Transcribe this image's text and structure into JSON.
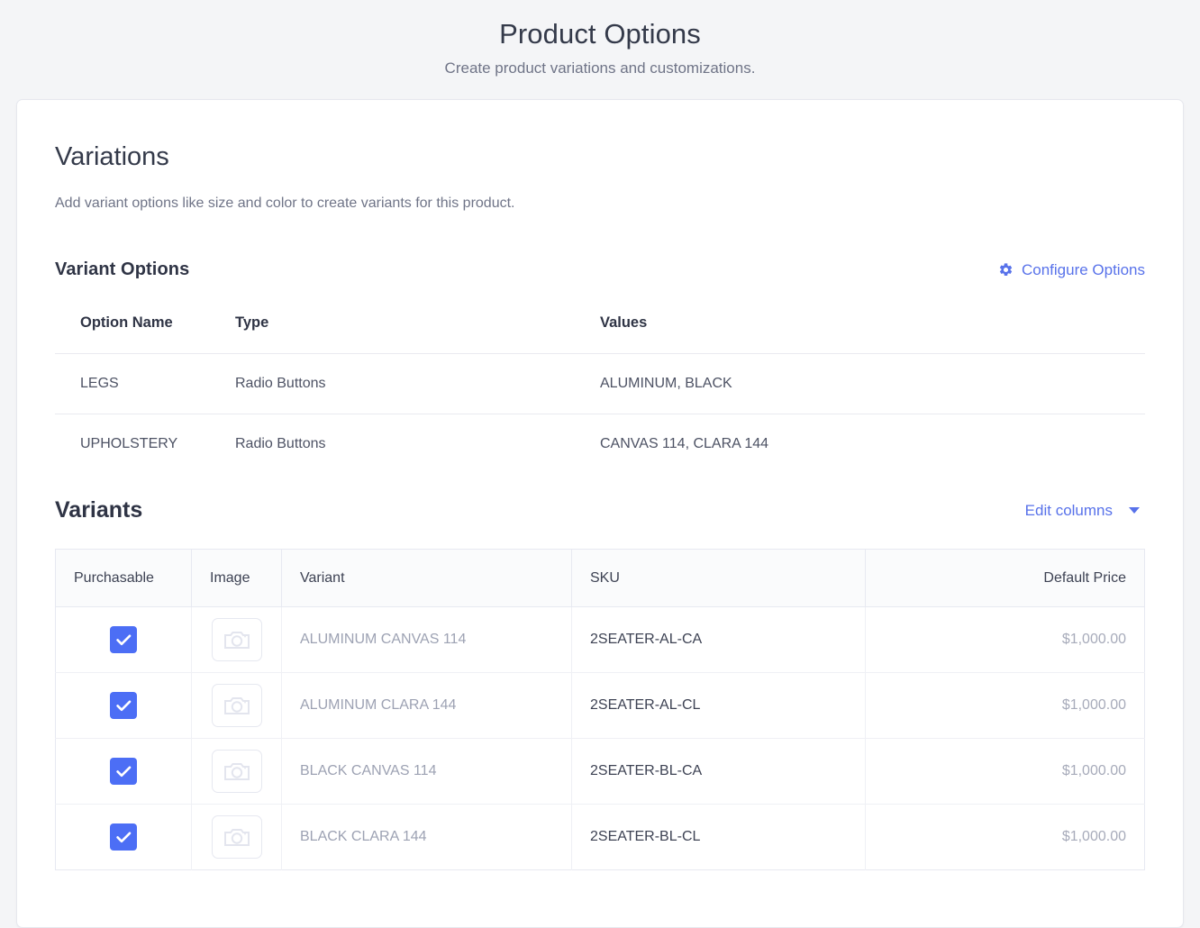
{
  "page": {
    "title": "Product Options",
    "subtitle": "Create product variations and customizations."
  },
  "variations": {
    "heading": "Variations",
    "description": "Add variant options like size and color to create variants for this product.",
    "options_heading": "Variant Options",
    "configure_link": "Configure Options",
    "configure_icon": "gear-icon",
    "options_columns": [
      "Option Name",
      "Type",
      "Values"
    ],
    "options_rows": [
      {
        "name": "LEGS",
        "type": "Radio Buttons",
        "values": "ALUMINUM, BLACK"
      },
      {
        "name": "UPHOLSTERY",
        "type": "Radio Buttons",
        "values": "CANVAS 114, CLARA 144"
      }
    ]
  },
  "variants": {
    "heading": "Variants",
    "edit_columns_label": "Edit columns",
    "edit_columns_icon": "chevron-down-icon",
    "columns": [
      "Purchasable",
      "Image",
      "Variant",
      "SKU",
      "Default Price"
    ],
    "rows": [
      {
        "purchasable": true,
        "image_icon": "camera-icon",
        "variant": "ALUMINUM CANVAS 114",
        "sku": "2SEATER-AL-CA",
        "price": "$1,000.00"
      },
      {
        "purchasable": true,
        "image_icon": "camera-icon",
        "variant": "ALUMINUM CLARA 144",
        "sku": "2SEATER-AL-CL",
        "price": "$1,000.00"
      },
      {
        "purchasable": true,
        "image_icon": "camera-icon",
        "variant": "BLACK CANVAS 114",
        "sku": "2SEATER-BL-CA",
        "price": "$1,000.00"
      },
      {
        "purchasable": true,
        "image_icon": "camera-icon",
        "variant": "BLACK CLARA 144",
        "sku": "2SEATER-BL-CL",
        "price": "$1,000.00"
      }
    ]
  },
  "colors": {
    "accent_blue": "#5872ea",
    "checkbox_blue": "#4c6ef5",
    "page_background": "#f4f5f7",
    "card_background": "#ffffff",
    "text_dark": "#343a4a",
    "text_muted": "#9da2b3"
  }
}
